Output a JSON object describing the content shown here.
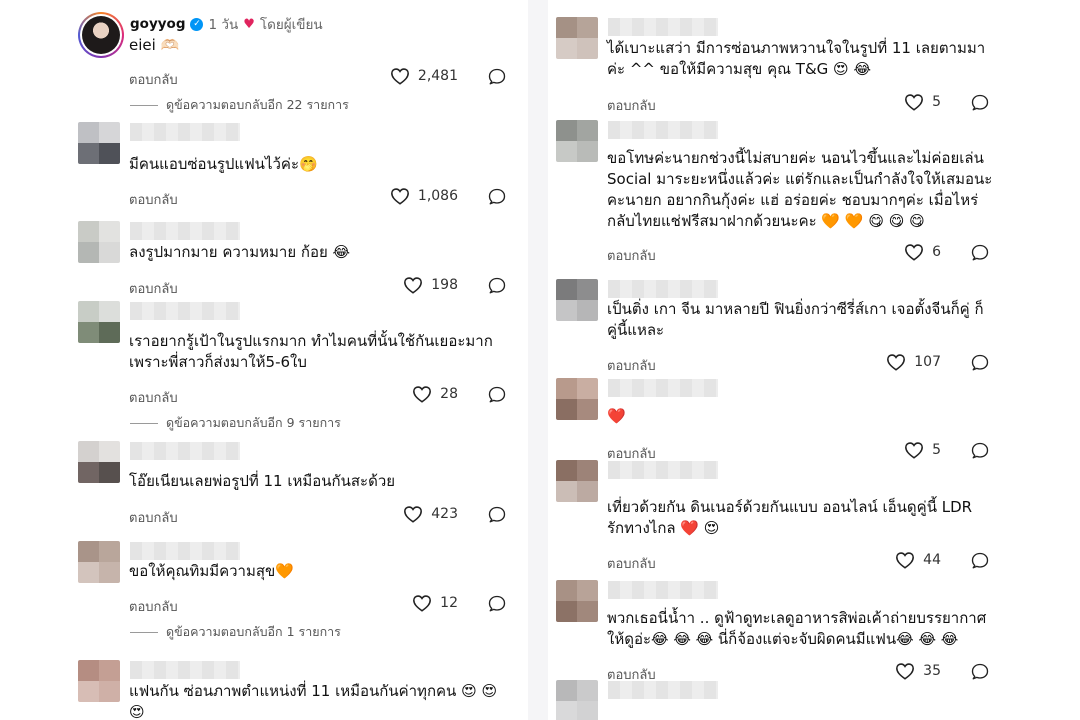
{
  "colors": {
    "verified": "#0095f6",
    "liked_heart": "#e0245e"
  },
  "owner_comment": {
    "username": "goyyog",
    "time": "1 วัน",
    "liked_by_author": "โดยผู้เขียน",
    "text": "eiei 🫶🏻",
    "reply_label": "ตอบกลับ",
    "likes": "2,481",
    "view_replies": "ดูข้อความตอบกลับอีก 22 รายการ"
  },
  "left_comments": [
    {
      "text": "มีคนแอบซ่อนรูปแฟนไว้ค่ะ🤭",
      "reply_label": "ตอบกลับ",
      "likes": "1,086"
    },
    {
      "text": "ลงรูปมากมาย ความหมาย ก้อย 😂",
      "reply_label": "ตอบกลับ",
      "likes": "198"
    },
    {
      "text": "เราอยากรู้เป้าในรูปแรกมาก ทำไมคนที่นั้นใช้กันเยอะมาก เพราะพี่สาวก็ส่งมาให้5-6ใบ",
      "reply_label": "ตอบกลับ",
      "likes": "28",
      "view_replies": "ดูข้อความตอบกลับอีก 9 รายการ"
    },
    {
      "text": "โอ๊ยเนียนเลยพ่อรูปที่ 11 เหมือนกันสะด้วย",
      "reply_label": "ตอบกลับ",
      "likes": "423"
    },
    {
      "text": "ขอให้คุณทิมมีความสุข🧡",
      "reply_label": "ตอบกลับ",
      "likes": "12",
      "view_replies": "ดูข้อความตอบกลับอีก 1 รายการ"
    },
    {
      "text": "แฟนกัน ซ่อนภาพตำแหน่งที่ 11 เหมือนกันค่าทุกคน 😍 😍 😍",
      "reply_label": "",
      "likes": ""
    }
  ],
  "right_comments": [
    {
      "text": "ได้เบาะแสว่า มีการซ่อนภาพหวานใจในรูปที่ 11 เลยตามมาค่ะ ^^ ขอให้มีความสุข คุณ T&G 😍 😂",
      "reply_label": "ตอบกลับ",
      "likes": "5"
    },
    {
      "text": "ขอโทษค่ะนายกช่วงนี้ไม่สบายค่ะ นอนไวขึ้นและไม่ค่อยเล่น Social มาระยะหนึ่งแล้วค่ะ แต่รักและเป็นกำลังใจให้เสมอนะคะนายก อยากกินกุ้งค่ะ แฮ่ อร่อยค่ะ ชอบมากๆค่ะ เมื่อไหร่กลับไทยแช่ฟรีสมาฝากด้วยนะคะ 🧡 🧡 😋 😋 😋",
      "reply_label": "ตอบกลับ",
      "likes": "6"
    },
    {
      "text": "เป็นติ่ง เกา จีน มาหลายปี ฟินยิ่งกว่าซีรี่ส์เกา เจอตั้งจีนก็คู่ ก็คู่นี้แหละ",
      "reply_label": "ตอบกลับ",
      "likes": "107"
    },
    {
      "text": "❤️",
      "reply_label": "ตอบกลับ",
      "likes": "5"
    },
    {
      "text": "เที่ยวด้วยกัน ดินเนอร์ด้วยกันแบบ ออนไลน์ เอ็นดูคู่นี้ LDR รักทางไกล ❤️ 😍",
      "reply_label": "ตอบกลับ",
      "likes": "44"
    },
    {
      "text": "พวกเธอนี่น้ำา .. ดูฟ้าดูทะเลดูอาหารสิพ่อเค้าถ่ายบรรยากาศให้ดูอ่ะ😂 😂 😂  นี่ก็จ้องแต่จะจับผิดคนมีแฟน😂 😂 😂",
      "reply_label": "ตอบกลับ",
      "likes": "35"
    }
  ]
}
